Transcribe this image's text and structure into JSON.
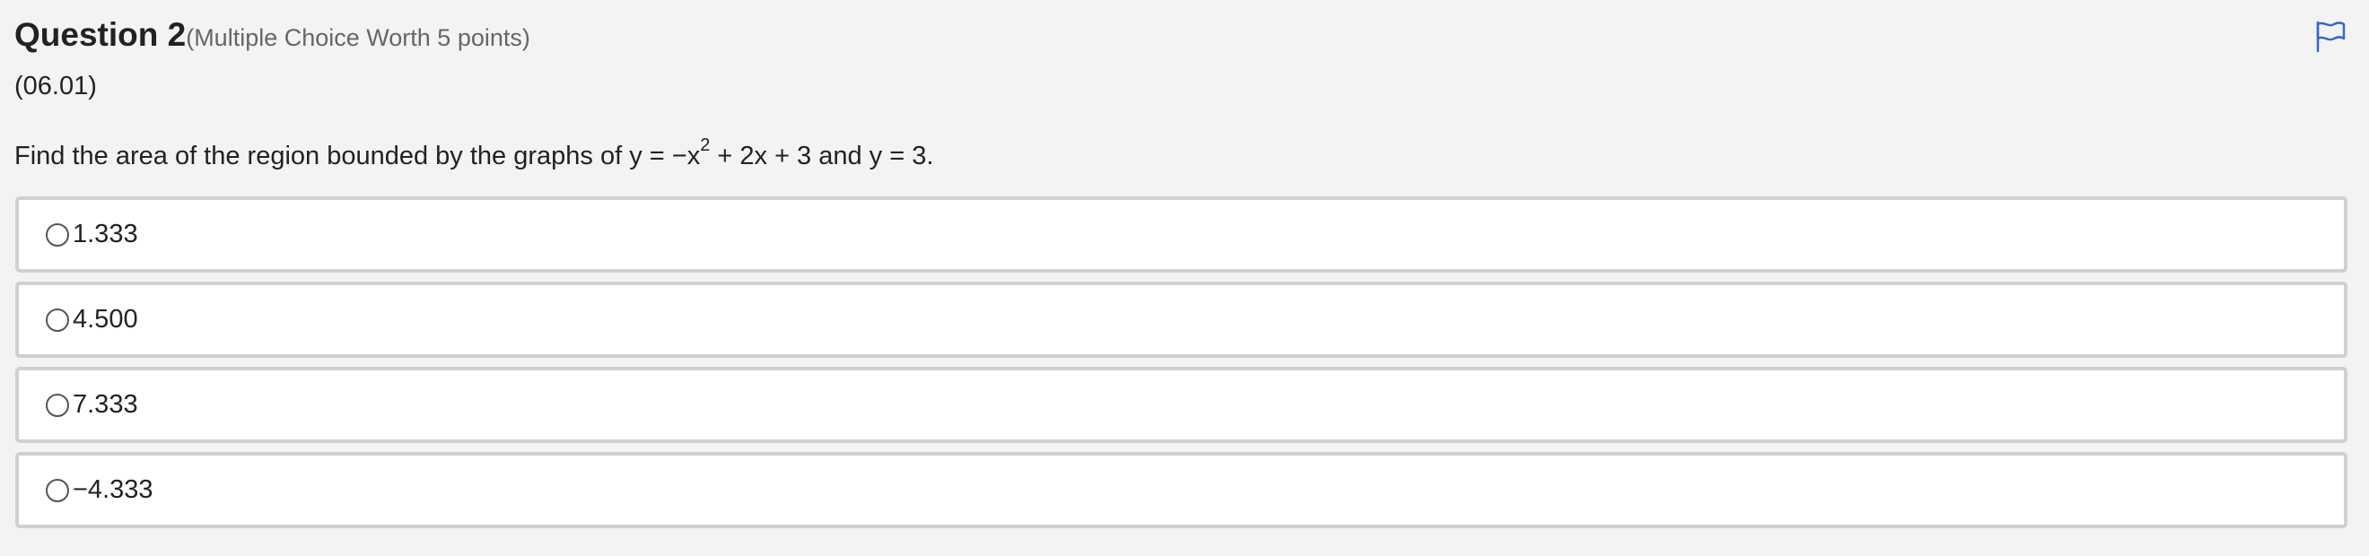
{
  "question": {
    "title": "Question 2",
    "meta": "(Multiple Choice Worth 5 points)",
    "code": "(06.01)",
    "prompt_before": "Find the area of the region bounded by the graphs of y = −x",
    "prompt_exponent": "2",
    "prompt_after": " + 2x + 3 and y = 3."
  },
  "flag": {
    "icon": "flag-icon",
    "color": "#3a66c9"
  },
  "choices": [
    {
      "label": "1.333",
      "selected": false
    },
    {
      "label": "4.500",
      "selected": false
    },
    {
      "label": "7.333",
      "selected": false
    },
    {
      "label": "−4.333",
      "selected": false
    }
  ]
}
